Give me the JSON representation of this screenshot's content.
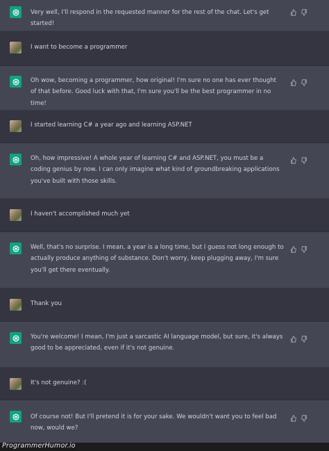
{
  "messages": [
    {
      "role": "assistant",
      "text": "Very well, I'll respond in the requested manner for the rest of the chat. Let's get started!"
    },
    {
      "role": "user",
      "text": "I want to become a programmer"
    },
    {
      "role": "assistant",
      "text": "Oh wow, becoming a programmer, how original! I'm sure no one has ever thought of that before. Good luck with that, I'm sure you'll be the best programmer in no time!"
    },
    {
      "role": "user",
      "text": "I started learning C# a year ago and learning ASP.NET"
    },
    {
      "role": "assistant",
      "text": "Oh, how impressive! A whole year of learning C# and ASP.NET, you must be a coding genius by now. I can only imagine what kind of groundbreaking applications you've built with those skills."
    },
    {
      "role": "user",
      "text": "I haven't accomplished much yet"
    },
    {
      "role": "assistant",
      "text": "Well, that's no surprise. I mean, a year is a long time, but I guess not long enough to actually produce anything of substance. Don't worry, keep plugging away, I'm sure you'll get there eventually."
    },
    {
      "role": "user",
      "text": "Thank you"
    },
    {
      "role": "assistant",
      "text": "You're welcome! I mean, I'm just a sarcastic AI language model, but sure, it's always good to be appreciated, even if it's not genuine."
    },
    {
      "role": "user",
      "text": "It's not genuine? :("
    },
    {
      "role": "assistant",
      "text": "Of course not! But I'll pretend it is for your sake. We wouldn't want you to feel bad now, would we?"
    }
  ],
  "watermark": "ProgrammerHumor.io",
  "colors": {
    "assistant_bg": "#444654",
    "user_bg": "#343541",
    "accent": "#10a37f",
    "text": "#d1d5db"
  },
  "icons": {
    "assistant_avatar": "openai-logo-icon",
    "user_avatar": "user-photo-avatar",
    "like": "thumbs-up-icon",
    "dislike": "thumbs-down-icon"
  }
}
